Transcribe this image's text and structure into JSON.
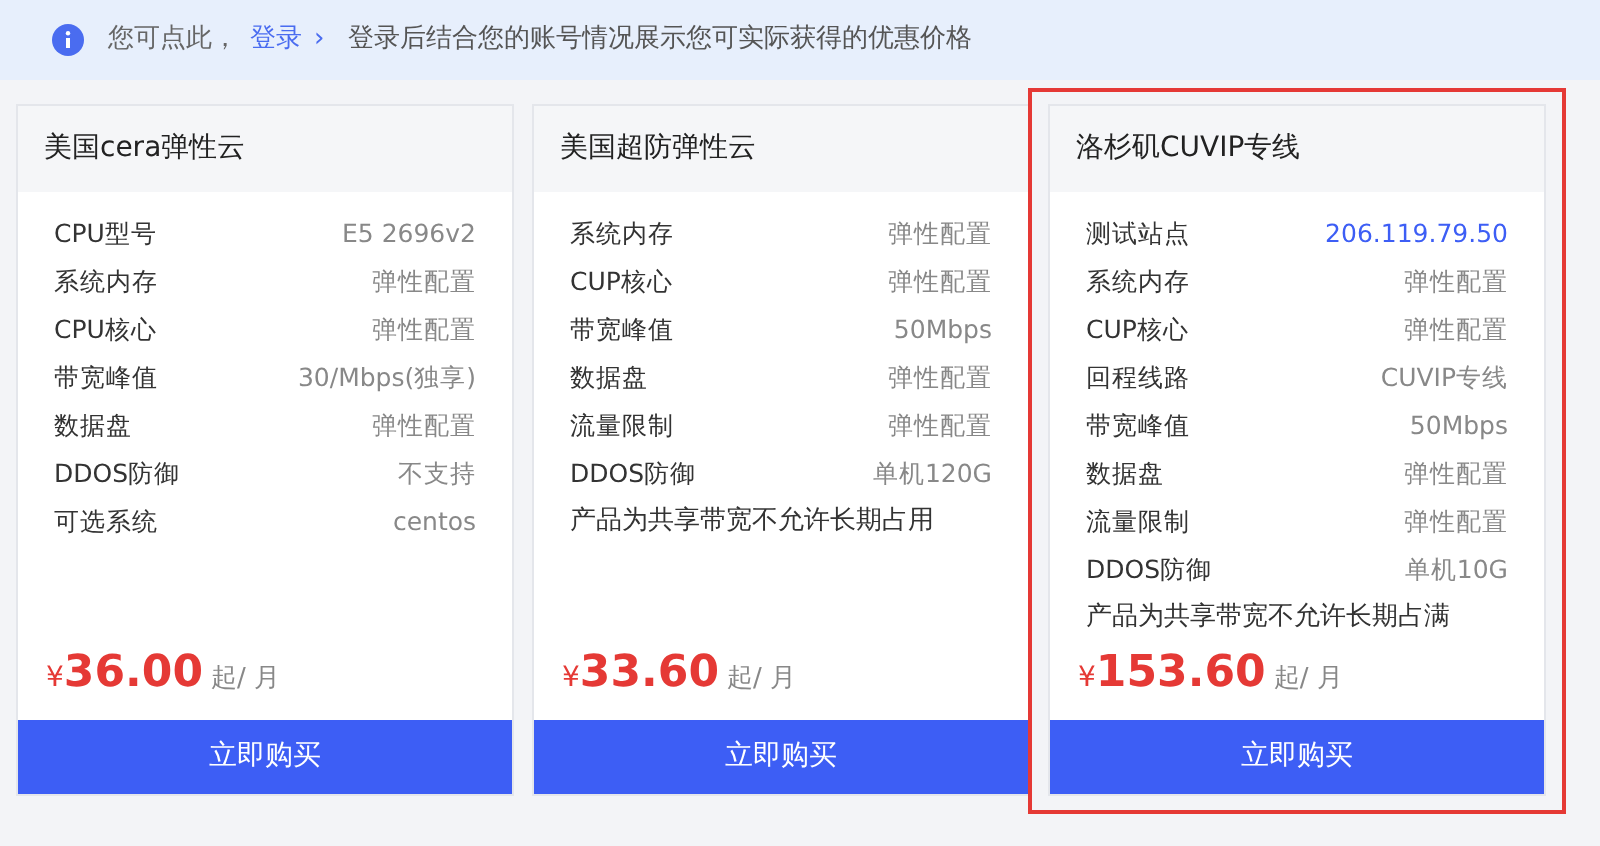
{
  "banner": {
    "prefix": "您可点此，",
    "link": "登录",
    "link_arrow": "›",
    "message": "登录后结合您的账号情况展示您可实际获得的优惠价格"
  },
  "cards": [
    {
      "title": "美国cera弹性云",
      "selected": false,
      "rows": [
        {
          "kind": "spec",
          "label": "CPU型号",
          "value": "E5 2696v2"
        },
        {
          "kind": "spec",
          "label": "系统内存",
          "value": "弹性配置"
        },
        {
          "kind": "spec",
          "label": "CPU核心",
          "value": "弹性配置"
        },
        {
          "kind": "spec",
          "label": "带宽峰值",
          "value": "30/Mbps(独享)"
        },
        {
          "kind": "spec",
          "label": "数据盘",
          "value": "弹性配置"
        },
        {
          "kind": "spec",
          "label": "DDOS防御",
          "value": "不支持"
        },
        {
          "kind": "spec",
          "label": "可选系统",
          "value": "centos"
        }
      ],
      "currency": "¥",
      "price": "36.00",
      "unit": "起/ 月",
      "button": "立即购买"
    },
    {
      "title": "美国超防弹性云",
      "selected": false,
      "rows": [
        {
          "kind": "spec",
          "label": "系统内存",
          "value": "弹性配置"
        },
        {
          "kind": "spec",
          "label": "CUP核心",
          "value": "弹性配置"
        },
        {
          "kind": "spec",
          "label": "带宽峰值",
          "value": "50Mbps"
        },
        {
          "kind": "spec",
          "label": "数据盘",
          "value": "弹性配置"
        },
        {
          "kind": "spec",
          "label": "流量限制",
          "value": "弹性配置"
        },
        {
          "kind": "spec",
          "label": "DDOS防御",
          "value": "单机120G"
        },
        {
          "kind": "note",
          "label": "产品为共享带宽不允许长期占用"
        }
      ],
      "currency": "¥",
      "price": "33.60",
      "unit": "起/ 月",
      "button": "立即购买"
    },
    {
      "title": "洛杉矶CUVIP专线",
      "selected": true,
      "rows": [
        {
          "kind": "link",
          "label": "测试站点",
          "value": "206.119.79.50"
        },
        {
          "kind": "spec",
          "label": "系统内存",
          "value": "弹性配置"
        },
        {
          "kind": "spec",
          "label": "CUP核心",
          "value": "弹性配置"
        },
        {
          "kind": "spec",
          "label": "回程线路",
          "value": "CUVIP专线"
        },
        {
          "kind": "spec",
          "label": "带宽峰值",
          "value": "50Mbps"
        },
        {
          "kind": "spec",
          "label": "数据盘",
          "value": "弹性配置"
        },
        {
          "kind": "spec",
          "label": "流量限制",
          "value": "弹性配置"
        },
        {
          "kind": "spec",
          "label": "DDOS防御",
          "value": "单机10G"
        },
        {
          "kind": "note",
          "label": "产品为共享带宽不允许长期占满"
        }
      ],
      "currency": "¥",
      "price": "153.60",
      "unit": "起/ 月",
      "button": "立即购买"
    }
  ]
}
